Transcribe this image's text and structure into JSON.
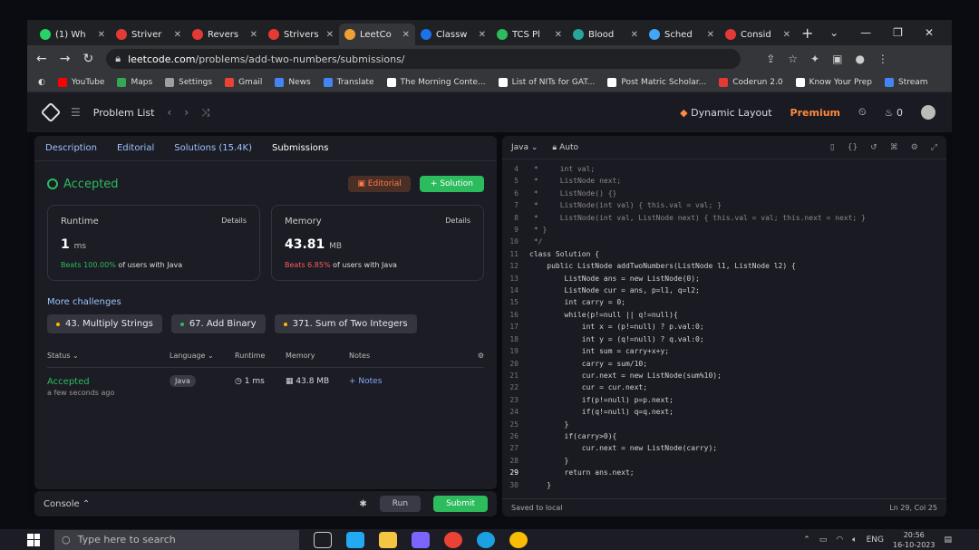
{
  "tabs": [
    {
      "title": "(1) Wh",
      "color": "#25d366",
      "active": false
    },
    {
      "title": "Striver",
      "color": "#e53935",
      "active": false
    },
    {
      "title": "Revers",
      "color": "#e53935",
      "active": false
    },
    {
      "title": "Strivers",
      "color": "#e53935",
      "active": false
    },
    {
      "title": "LeetCo",
      "color": "#f0a030",
      "active": true
    },
    {
      "title": "Classw",
      "color": "#1a73e8",
      "active": false
    },
    {
      "title": "TCS Pl",
      "color": "#2cbb5d",
      "active": false
    },
    {
      "title": "Blood",
      "color": "#26a69a",
      "active": false
    },
    {
      "title": "Sched",
      "color": "#42a5f5",
      "active": false
    },
    {
      "title": "Consid",
      "color": "#e53935",
      "active": false
    }
  ],
  "address": {
    "host": "leetcode.com",
    "path": "/problems/add-two-numbers/submissions/"
  },
  "bookmarks": [
    {
      "label": "YouTube",
      "color": "#ff0000"
    },
    {
      "label": "Maps",
      "color": "#34a853"
    },
    {
      "label": "Settings",
      "color": "#9e9e9e"
    },
    {
      "label": "Gmail",
      "color": "#ea4335"
    },
    {
      "label": "News",
      "color": "#4285f4"
    },
    {
      "label": "Translate",
      "color": "#4285f4"
    },
    {
      "label": "The Morning Conte...",
      "color": "#ffffff"
    },
    {
      "label": "List of NITs for GAT...",
      "color": "#ffffff"
    },
    {
      "label": "Post Matric Scholar...",
      "color": "#ffffff"
    },
    {
      "label": "Coderun 2.0",
      "color": "#e53935"
    },
    {
      "label": "Know Your Prep",
      "color": "#ffffff"
    },
    {
      "label": "Stream",
      "color": "#4285f4"
    }
  ],
  "lc": {
    "problem_list": "Problem List",
    "dynamic_layout": "Dynamic Layout",
    "premium": "Premium",
    "streak": "0",
    "left_tabs": [
      "Description",
      "Editorial",
      "Solutions (15.4K)",
      "Submissions"
    ],
    "status": "Accepted",
    "editorial_btn": "Editorial",
    "solution_btn": "Solution",
    "runtime": {
      "label": "Runtime",
      "details": "Details",
      "value": "1",
      "unit": "ms",
      "beats": "Beats 100.00%",
      "suffix": "of users with Java"
    },
    "memory": {
      "label": "Memory",
      "details": "Details",
      "value": "43.81",
      "unit": "MB",
      "beats": "Beats 6.85%",
      "suffix": "of users with Java"
    },
    "more_challenges": "More challenges",
    "challenges": [
      {
        "label": "43. Multiply Strings",
        "color": "#ffb800"
      },
      {
        "label": "67. Add Binary",
        "color": "#2cbb5d"
      },
      {
        "label": "371. Sum of Two Integers",
        "color": "#ffb800"
      }
    ],
    "table": {
      "headers": [
        "Status",
        "Language",
        "Runtime",
        "Memory",
        "Notes"
      ],
      "row": {
        "status": "Accepted",
        "time": "a few seconds ago",
        "lang": "Java",
        "runtime": "1 ms",
        "memory": "43.8 MB",
        "notes": "Notes"
      }
    },
    "console": "Console",
    "run": "Run",
    "submit": "Submit",
    "editor": {
      "language": "Java",
      "mode": "Auto",
      "saved": "Saved to local",
      "position": "Ln 29, Col 25",
      "lines": [
        {
          "n": "4",
          "t": " *     int val;"
        },
        {
          "n": "5",
          "t": " *     ListNode next;"
        },
        {
          "n": "6",
          "t": " *     ListNode() {}"
        },
        {
          "n": "7",
          "t": " *     ListNode(int val) { this.val = val; }"
        },
        {
          "n": "8",
          "t": " *     ListNode(int val, ListNode next) { this.val = val; this.next = next; }"
        },
        {
          "n": "9",
          "t": " * }"
        },
        {
          "n": "10",
          "t": " */"
        },
        {
          "n": "11",
          "t": "class Solution {"
        },
        {
          "n": "12",
          "t": "    public ListNode addTwoNumbers(ListNode l1, ListNode l2) {"
        },
        {
          "n": "13",
          "t": "        ListNode ans = new ListNode(0);"
        },
        {
          "n": "14",
          "t": "        ListNode cur = ans, p=l1, q=l2;"
        },
        {
          "n": "15",
          "t": "        int carry = 0;"
        },
        {
          "n": "16",
          "t": "        while(p!=null || q!=null){"
        },
        {
          "n": "17",
          "t": "            int x = (p!=null) ? p.val:0;"
        },
        {
          "n": "18",
          "t": "            int y = (q!=null) ? q.val:0;"
        },
        {
          "n": "19",
          "t": "            int sum = carry+x+y;"
        },
        {
          "n": "20",
          "t": "            carry = sum/10;"
        },
        {
          "n": "21",
          "t": "            cur.next = new ListNode(sum%10);"
        },
        {
          "n": "22",
          "t": "            cur = cur.next;"
        },
        {
          "n": "23",
          "t": "            if(p!=null) p=p.next;"
        },
        {
          "n": "24",
          "t": "            if(q!=null) q=q.next;"
        },
        {
          "n": "25",
          "t": "        }"
        },
        {
          "n": "26",
          "t": "        if(carry>0){"
        },
        {
          "n": "27",
          "t": "            cur.next = new ListNode(carry);"
        },
        {
          "n": "28",
          "t": "        }"
        },
        {
          "n": "29",
          "t": "        return ans.next;"
        },
        {
          "n": "30",
          "t": "    }"
        }
      ]
    }
  },
  "taskbar": {
    "search_placeholder": "Type here to search",
    "lang": "ENG",
    "time": "20:56",
    "date": "16-10-2023"
  }
}
